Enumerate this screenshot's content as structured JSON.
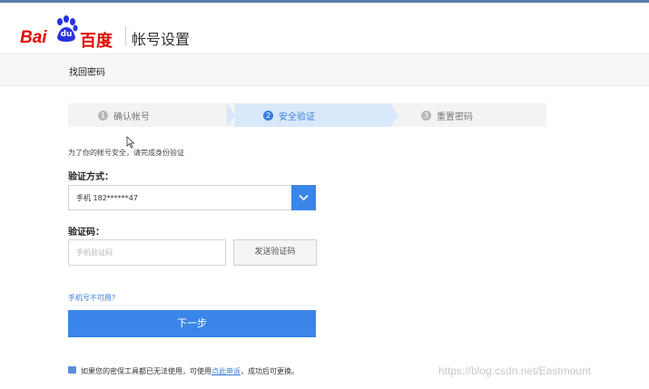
{
  "header": {
    "logo_bai": "Bai",
    "logo_du": "du",
    "logo_cn": "百度",
    "title": "帐号设置"
  },
  "subbar": {
    "label": "找回密码"
  },
  "steps": [
    {
      "num": "1",
      "label": "确认帐号",
      "active": false
    },
    {
      "num": "2",
      "label": "安全验证",
      "active": true
    },
    {
      "num": "3",
      "label": "重置密码",
      "active": false
    }
  ],
  "form": {
    "notice": "为了你的帐号安全，请完成身份验证",
    "method_label": "验证方式：",
    "method_value": "手机 182******47",
    "code_label": "验证码：",
    "code_placeholder": "手机验证码",
    "send_code_label": "发送验证码",
    "phone_unavailable_link": "手机号不可用?",
    "next_label": "下一步"
  },
  "footer": {
    "text_before": "如果您的密保工具都已无法使用，可使用",
    "link_text": "点此申诉",
    "text_after": "，成功后可更换。"
  },
  "watermark": "https://blog.csdn.net/Eastmount",
  "colors": {
    "brand_red": "#e10601",
    "accent_blue": "#3a86e8",
    "active_step_bg": "#d9e8fb"
  }
}
